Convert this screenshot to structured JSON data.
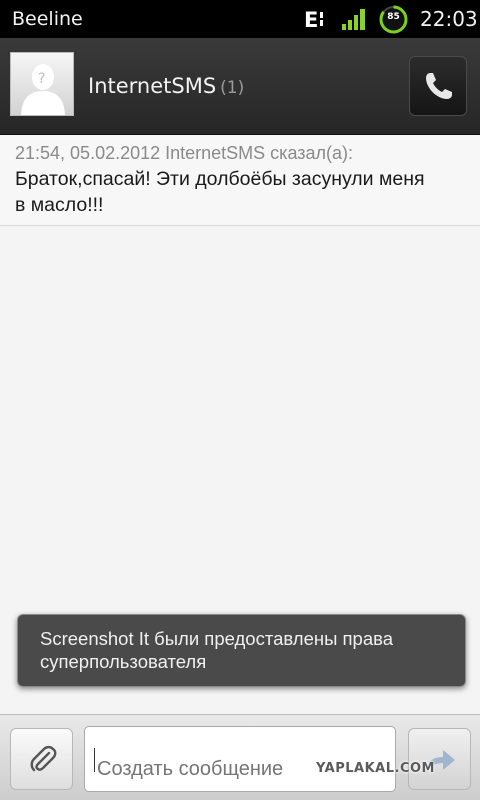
{
  "status_bar": {
    "carrier": "Beeline",
    "network_icon": "edge-network-icon",
    "signal_icon": "signal-strength-icon",
    "battery_level": "85",
    "time": "22:03"
  },
  "header": {
    "contact_name": "InternetSMS",
    "message_count": "(1)",
    "avatar_icon": "contact-placeholder-icon",
    "call_icon": "phone-icon"
  },
  "message": {
    "meta": "21:54, 05.02.2012 InternetSMS сказал(а):",
    "body": "Браток,спасай! Эти долбоёбы засунули меня в масло!!!"
  },
  "toast": {
    "text": "Screenshot It были предоставлены права суперпользователя"
  },
  "compose": {
    "placeholder": "Создать сообщение",
    "attach_icon": "paperclip-icon",
    "send_icon": "send-arrow-icon"
  },
  "watermark": "YAPLAKAL.COM",
  "colors": {
    "header_bg": "#2e2e2e",
    "battery_green": "#7bd11f",
    "signal_green": "#8ad12a"
  }
}
